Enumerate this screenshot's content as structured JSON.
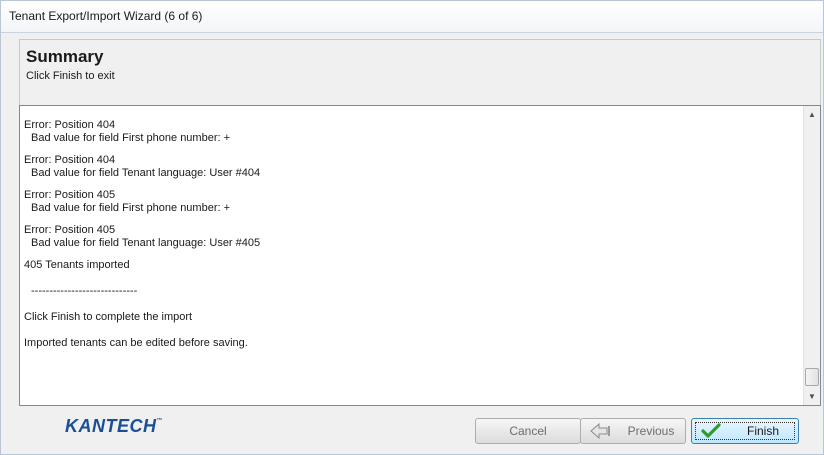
{
  "window": {
    "title": "Tenant Export/Import Wizard (6 of 6)"
  },
  "header": {
    "title": "Summary",
    "subtitle": "Click Finish to exit"
  },
  "log": {
    "entries": [
      {
        "head": "Error: Position 404",
        "detail": "Bad value for field First phone number: +"
      },
      {
        "head": "Error: Position 404",
        "detail": "Bad value for field Tenant language: User #404"
      },
      {
        "head": "Error: Position 405",
        "detail": "Bad value for field First phone number: +"
      },
      {
        "head": "Error: Position 405",
        "detail": "Bad value for field Tenant language: User #405"
      }
    ],
    "imported": "405 Tenants imported",
    "separator": "-----------------------------",
    "finish_hint": "Click Finish to complete the import",
    "edit_hint": "Imported tenants can be edited before saving."
  },
  "scrollbar": {
    "position_fraction": 0.95
  },
  "footer": {
    "logo": "KANTECH",
    "logo_mark": "™",
    "cancel_label": "Cancel",
    "previous_label": "Previous",
    "finish_label": "Finish"
  },
  "icons": {
    "up": "scroll-up-arrow-icon",
    "down": "scroll-down-arrow-icon",
    "previous": "back-arrow-icon",
    "finish": "checkmark-icon"
  },
  "colors": {
    "logo": "#1a4f96",
    "finish_check": "#2a9d2a",
    "finish_border": "#3c7fb1"
  }
}
